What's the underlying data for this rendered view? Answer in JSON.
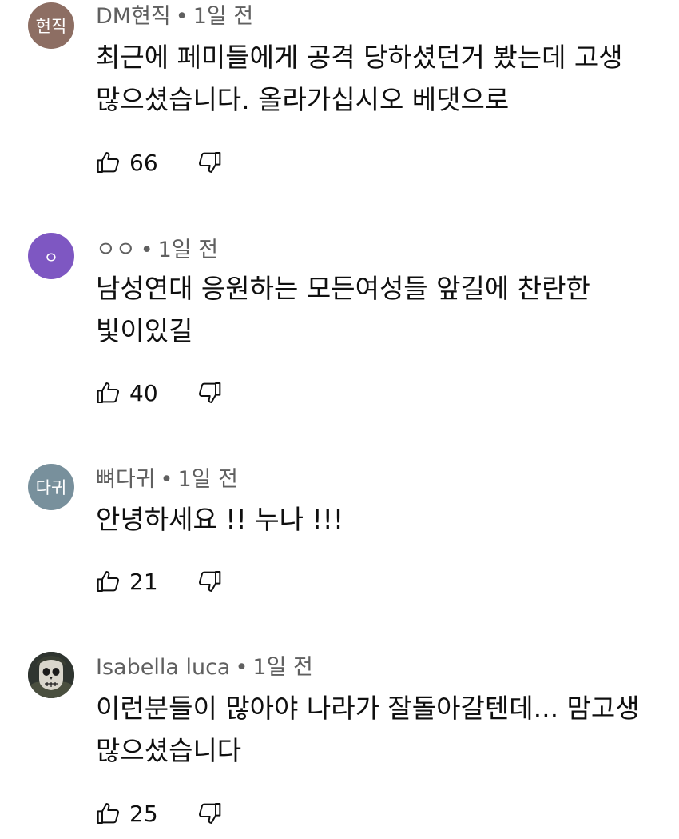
{
  "comments": [
    {
      "avatar_text": "현직",
      "avatar_color": "#8d6e63",
      "author": "DM현직",
      "time": "1일 전",
      "lines": [
        "최근에 페미들에게 공격 당하셨던거 봤는데 고생",
        "많으셨습니다. 올라가십시오 베댓으로"
      ],
      "likes": "66"
    },
    {
      "avatar_text": "ㅇ",
      "avatar_color": "#7e57c2",
      "author": "ㅇㅇ",
      "time": "1일 전",
      "lines": [
        "남성연대 응원하는 모든여성들 앞길에 찬란한",
        "빛이있길"
      ],
      "likes": "40"
    },
    {
      "avatar_text": "다귀",
      "avatar_color": "#78909c",
      "author": "뼈다귀",
      "time": "1일 전",
      "lines": [
        "안녕하세요 !! 누나 !!!"
      ],
      "likes": "21"
    },
    {
      "avatar_text": "",
      "avatar_color": "#2a2f2b",
      "author": "Isabella luca",
      "time": "1일 전",
      "lines": [
        "이런분들이 많아야 나라가 잘돌아갈텐데... 맘고생",
        "많으셨습니다"
      ],
      "likes": "25"
    }
  ],
  "separator": "•",
  "icons": {
    "like": "thumb-up-icon",
    "dislike": "thumb-down-icon"
  }
}
